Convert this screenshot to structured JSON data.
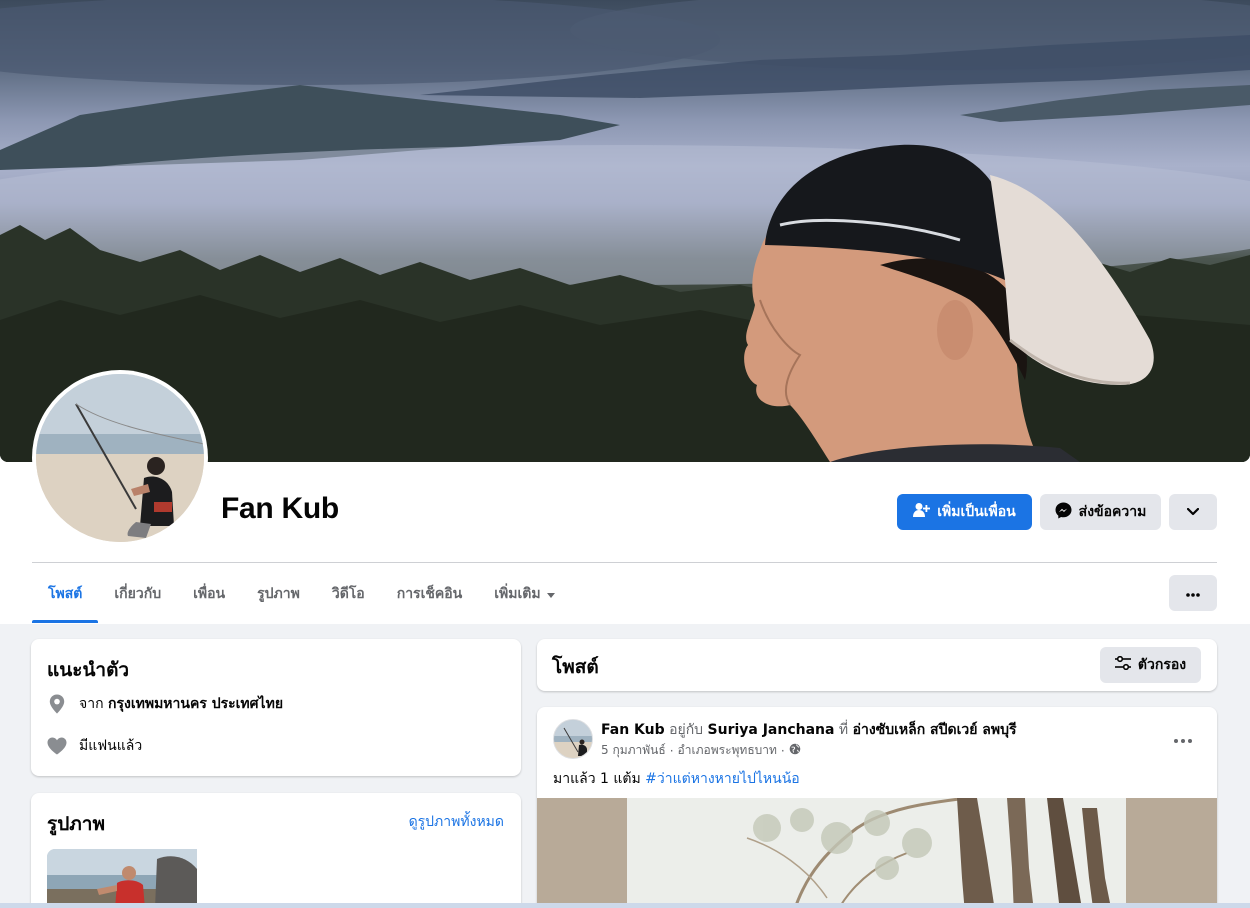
{
  "profile": {
    "name": "Fan Kub"
  },
  "actions": {
    "add_friend": "เพิ่มเป็นเพื่อน",
    "message": "ส่งข้อความ"
  },
  "tabs": [
    {
      "label": "โพสต์"
    },
    {
      "label": "เกี่ยวกับ"
    },
    {
      "label": "เพื่อน"
    },
    {
      "label": "รูปภาพ"
    },
    {
      "label": "วิดีโอ"
    },
    {
      "label": "การเช็คอิน"
    },
    {
      "label": "เพิ่มเติม"
    }
  ],
  "intro": {
    "title": "แนะนำตัว",
    "from_prefix": "จาก",
    "from_place": "กรุงเทพมหานคร ประเทศไทย",
    "relationship": "มีแฟนแล้ว"
  },
  "photos": {
    "title": "รูปภาพ",
    "see_all": "ดูรูปภาพทั้งหมด"
  },
  "posts": {
    "title": "โพสต์",
    "filter_label": "ตัวกรอง"
  },
  "post": {
    "author": "Fan Kub",
    "with_text": "อยู่กับ",
    "with_name": "Suriya Janchana",
    "at_text": "ที่",
    "place": "อ่างซับเหล็ก สปีดเวย์ ลพบุรี",
    "date": "5 กุมภาพันธ์",
    "location": "อำเภอพระพุทธบาท",
    "text": "มาแล้ว 1 แต้ม",
    "hashtag": "#ว่าแต่หางหายไปไหนน้อ"
  },
  "colors": {
    "primary": "#1b74e4",
    "page_bg": "#f0f2f5",
    "secondary_button": "#e4e6eb"
  }
}
